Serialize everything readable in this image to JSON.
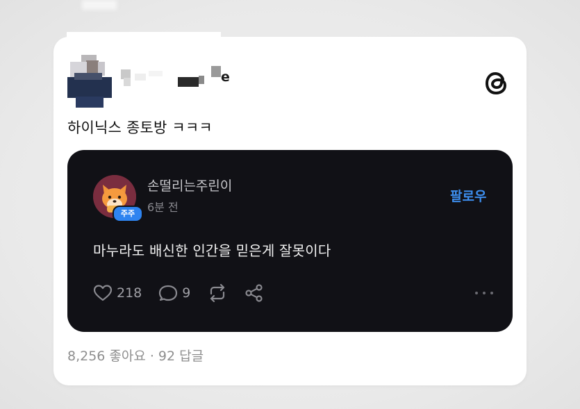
{
  "post": {
    "username_suffix": "e",
    "text": "하이닉스 종토방 ㅋㅋㅋ",
    "likes_text": "8,256 좋아요",
    "separator": "·",
    "replies_text": "92 답글"
  },
  "quoted": {
    "name": "손떨리는주린이",
    "badge": "주주",
    "time": "6분 전",
    "follow_label": "팔로우",
    "text": "마누라도 배신한 인간을 믿은게 잘못이다",
    "like_count": "218",
    "comment_count": "9"
  },
  "colors": {
    "accent": "#3d8ff0",
    "dark_card": "#111116",
    "badge": "#2e84f0"
  },
  "icons": [
    "threads-logo-icon",
    "heart-icon",
    "comment-icon",
    "repost-icon",
    "share-icon",
    "more-icon"
  ]
}
